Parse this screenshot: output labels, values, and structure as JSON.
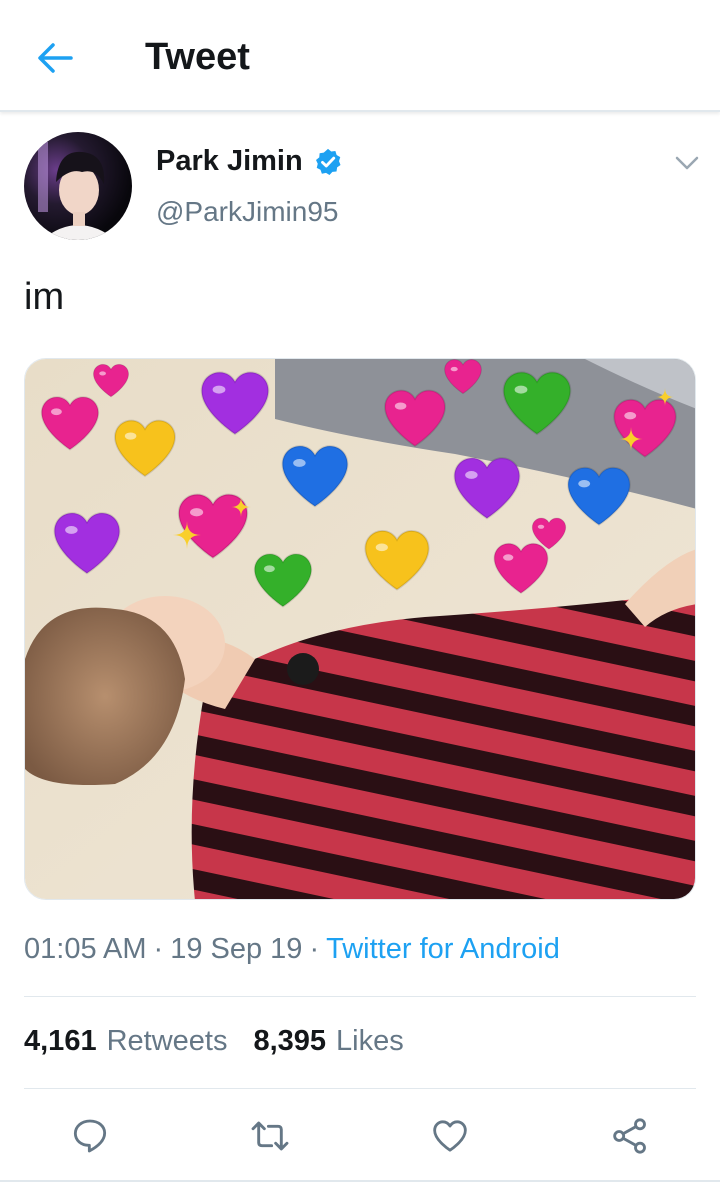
{
  "header": {
    "title": "Tweet",
    "back_icon": "arrow-left-icon"
  },
  "author": {
    "display_name": "Park Jimin",
    "handle": "@ParkJimin95",
    "verified": true,
    "verified_icon": "verified-badge-icon",
    "menu_icon": "chevron-down-icon"
  },
  "tweet": {
    "text": "im",
    "media_icons": [
      "heart-icon",
      "sparkle-icon"
    ],
    "time": "01:05 AM",
    "date": "19 Sep 19",
    "separator": "·",
    "source": "Twitter for Android"
  },
  "stats": {
    "retweets_count": "4,161",
    "retweets_label": "Retweets",
    "likes_count": "8,395",
    "likes_label": "Likes"
  },
  "actions": [
    "reply-icon",
    "retweet-icon",
    "like-icon",
    "share-icon"
  ],
  "colors": {
    "accent": "#1da1f2",
    "text_primary": "#14171a",
    "text_secondary": "#657786",
    "divider": "#e1e8ed"
  }
}
